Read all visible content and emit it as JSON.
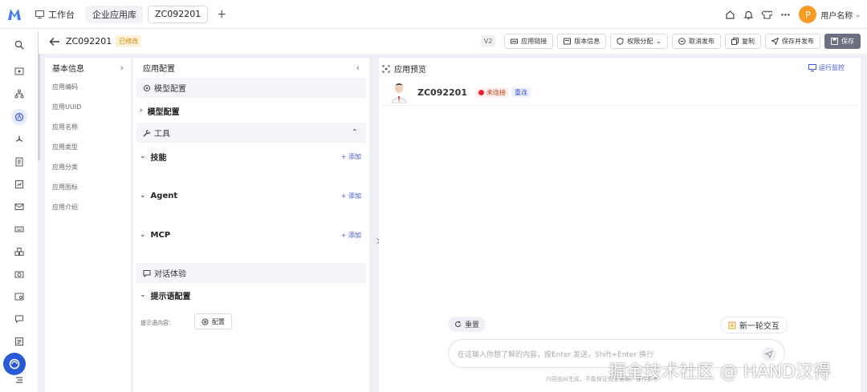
{
  "topbar": {
    "tabs": [
      {
        "label": "工作台",
        "icon": "monitor-icon"
      },
      {
        "label": "企业应用库"
      },
      {
        "label": "ZC092201",
        "active": true
      }
    ],
    "add_tab": "+",
    "user_initial": "P",
    "user_name": "用户名称"
  },
  "header": {
    "title": "ZC092201",
    "status": "已修改",
    "version": "V2",
    "buttons": [
      {
        "label": "应用链接",
        "icon": "link-icon"
      },
      {
        "label": "版本信息",
        "icon": "version-icon"
      },
      {
        "label": "权限分配",
        "icon": "shield-icon"
      },
      {
        "label": "取消发布",
        "icon": "minus-circle-icon"
      },
      {
        "label": "复制",
        "icon": "copy-icon"
      },
      {
        "label": "保存并发布",
        "icon": "send-icon"
      },
      {
        "label": "保存",
        "icon": "save-icon"
      }
    ]
  },
  "basic_info": {
    "title": "基本信息",
    "items": [
      "应用编码",
      "应用UUID",
      "应用名称",
      "应用类型",
      "应用分类",
      "应用图标",
      "应用介绍"
    ]
  },
  "config": {
    "title": "应用配置",
    "model_section": "模型配置",
    "model_group": "模型配置",
    "tools_section": "工具",
    "groups": [
      {
        "label": "技能",
        "add": "添加"
      },
      {
        "label": "Agent",
        "add": "添加"
      },
      {
        "label": "MCP",
        "add": "添加"
      }
    ],
    "dialog_section": "对话体验",
    "prompt_group": "提示语配置",
    "prompt_label": "提示语内容：",
    "config_button": "配置"
  },
  "preview": {
    "title": "应用预览",
    "monitor": "运行监控",
    "agent_name": "ZC092201",
    "status": "未连接",
    "reconnect": "重连",
    "reset": "重置",
    "new_round": "新一轮交互",
    "input_placeholder": "在这输入你想了解的内容，按Enter 发送，Shift+Enter 换行",
    "disclaimer": "内容由AI生成，不能保证完全准确，谨作参考"
  },
  "watermark": "掘金技术社区 @ HAND汉得",
  "colors": {
    "accent": "#3a56d4",
    "avatar": "#f59a23",
    "modified": "#d48806",
    "danger": "#f5222d"
  }
}
